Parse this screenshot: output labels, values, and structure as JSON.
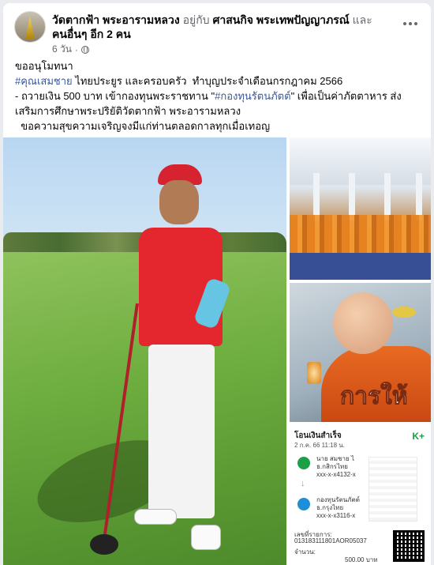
{
  "post": {
    "page_name": "วัดตากฟ้า พระอารามหลวง",
    "with_text": "อยู่กับ",
    "tagged_name": "ศาสนกิจ พระเทพปัญญาภรณ์",
    "and_text": "และ",
    "others": "คนอื่นๆ อีก 2 คน",
    "time": "6 วัน",
    "privacy_icon": "globe-icon",
    "more_icon": "more-dots-icon",
    "line1": "ขออนุโมทนา",
    "hashtag1": "#คุณเสมชาย",
    "line2_rest": " ไทยประยูร และครอบครัว  ทำบุญประจำเดือนกรกฎาคม 2566",
    "line3_pre": "- ถวายเงิน 500 บาท เข้ากองทุนพระราชทาน \"",
    "hashtag2": "#กองทุนรัตนภัตต์",
    "line3_post": "\" เพื่อเป็นค่าภัตตาหาร ส่งเสริมการศึกษาพระปริยัติวัดตากฟ้า พระอารามหลวง",
    "line4": "  ขอความสุขความเจริญจงมีแก่ท่านตลอดกาลทุกเมื่อเทอญ"
  },
  "photos": {
    "monk_caption": "การให้",
    "slip": {
      "title": "โอนเงินสำเร็จ",
      "date": "2 ก.ค. 66 11:18 น.",
      "brand": "K+",
      "from_name": "นาย สมชาย ไ",
      "from_bank": "ธ.กสิกรไทย",
      "from_acct": "xxx-x-x4132-x",
      "to_name": "กองทุนรัตนภัตต์",
      "to_bank": "ธ.กรุงไทย",
      "to_acct": "xxx-x-x3116-x",
      "ref_label": "เลขที่รายการ:",
      "ref_value": "013183111801AOR05037",
      "amount_label": "จำนวน:",
      "amount_value": "500.00 บาท"
    }
  }
}
